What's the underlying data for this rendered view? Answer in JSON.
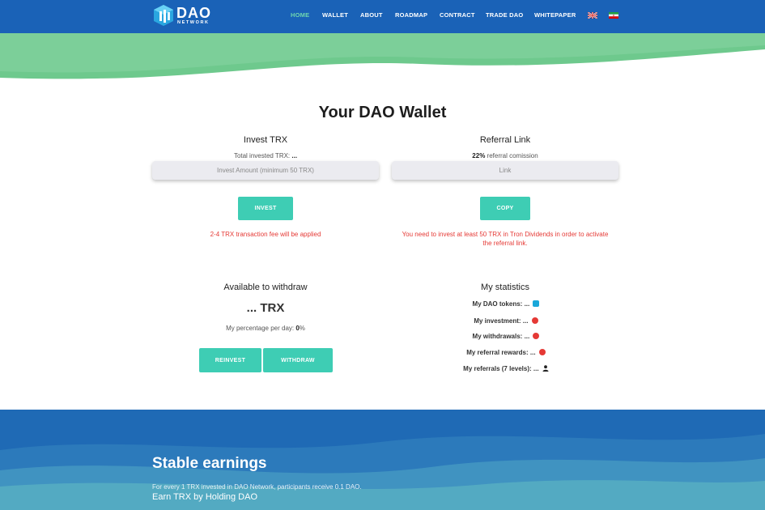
{
  "header": {
    "logo_text": "DAO",
    "logo_sub": "NETWORK",
    "nav": [
      "HOME",
      "WALLET",
      "ABOUT",
      "ROADMAP",
      "CONTRACT",
      "TRADE DAO",
      "WHITEPAPER"
    ],
    "active_nav": "HOME",
    "languages": [
      "English",
      "Persian"
    ]
  },
  "wallet": {
    "title": "Your DAO Wallet",
    "invest": {
      "heading": "Invest TRX",
      "total_label": "Total invested TRX:",
      "total_value": "...",
      "input_placeholder": "Invest Amount (minimum 50 TRX)",
      "button": "INVEST",
      "note": "2-4 TRX transaction fee will be applied"
    },
    "referral": {
      "heading": "Referral Link",
      "commission_value": "22%",
      "commission_label": "referral comission",
      "input_placeholder": "Link",
      "button": "COPY",
      "note_line1": "You need to invest at least 50 TRX in Tron Dividends in order to activate",
      "note_line2": "the referral link."
    },
    "withdraw": {
      "heading": "Available to withdraw",
      "amount": "... TRX",
      "percentage_label": "My percentage per day:",
      "percentage_value": "0",
      "percentage_unit": "%",
      "reinvest_button": "REINVEST",
      "withdraw_button": "WITHDRAW"
    },
    "statistics": {
      "heading": "My statistics",
      "rows": [
        {
          "label": "My DAO tokens:",
          "value": "...",
          "icon": "dao-icon"
        },
        {
          "label": "My investment:",
          "value": "...",
          "icon": "tron-icon"
        },
        {
          "label": "My withdrawals:",
          "value": "...",
          "icon": "tron-icon"
        },
        {
          "label": "My referral rewards:",
          "value": "...",
          "icon": "tron-icon"
        },
        {
          "label": "My referrals (7 levels):",
          "value": "...",
          "icon": "user-icon"
        }
      ]
    }
  },
  "footer": {
    "title": "Stable earnings",
    "text": "For every 1 TRX invested in DAO Network, participants receive 0.1 DAO.",
    "subtitle": "Earn TRX by Holding DAO"
  },
  "colors": {
    "header": "#1a62b7",
    "accent": "#3ecdb4",
    "wave": "#6ec98d",
    "warning": "#e53935",
    "footer": "#1f6ab5"
  }
}
